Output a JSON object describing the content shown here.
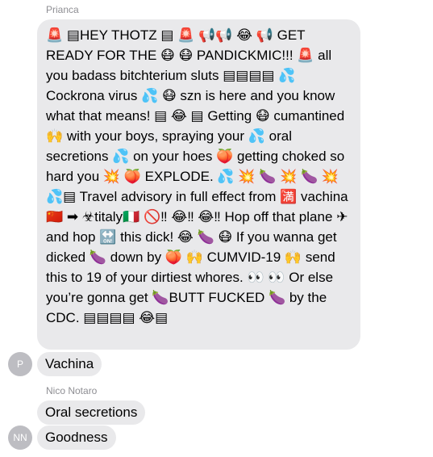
{
  "thread": {
    "messages": [
      {
        "sender": "Prianca",
        "text": "🚨 ▤HEY THOTZ ▤ 🚨 📢📢 😂 📢 GET READY FOR THE 😷 😷 PANDICKMIC!!! 🚨 all you badass bitchterium sluts ▤▤▤▤ 💦 Cockrona virus 💦 😷 szn is here and you know what that means! ▤ 😂 ▤ Getting 😷 cumantined 🙌 with your boys, spraying your 💦 oral secretions 💦 on your hoes 🍑 getting choked so hard you 💥 🍑 EXPLODE. 💦 💥 🍆 💥 🍆 💥💦▤ Travel advisory in full effect from 🈵 vachina🇨🇳 ➡ ☣titaly🇮🇹 🚫‼ 😂‼ 😂‼ Hop off that plane ✈ and hop 🔛 this dick! 😂 🍆 😷 If you wanna get dicked 🍆 down by 🍑 🙌 CUMVID-19 🙌 send this to 19 of your dirtiest whores. 👀 👀 Or else you’re gonna get 🍆BUTT FUCKED 🍆 by the CDC. ▤▤▤▤ 😂▤"
      },
      {
        "avatar": "P",
        "text": "Vachina"
      },
      {
        "sender": "Nico Notaro",
        "text": "Oral secretions"
      },
      {
        "avatar": "NN",
        "text": "Goodness"
      }
    ]
  },
  "colors": {
    "bubble": "#e9e9eb",
    "sender_label": "#8e8e93",
    "avatar": "#bdbdc2"
  }
}
